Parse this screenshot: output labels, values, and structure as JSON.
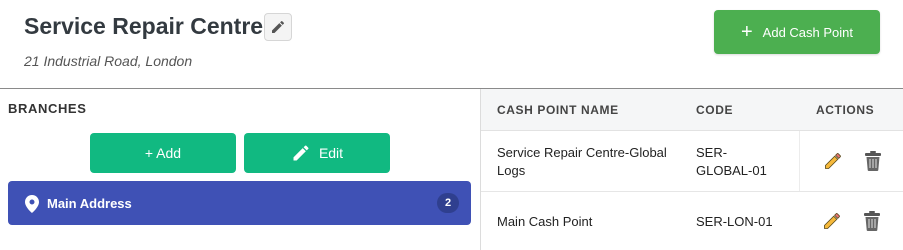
{
  "header": {
    "title": "Service Repair Centre",
    "address": "21 Industrial Road, London",
    "add_cash_point_label": "Add Cash Point"
  },
  "branches": {
    "title": "BRANCHES",
    "add_label": "+ Add",
    "edit_label": "Edit",
    "items": [
      {
        "label": "Main Address",
        "count": "2"
      }
    ]
  },
  "table": {
    "columns": [
      "CASH POINT NAME",
      "CODE",
      "ACTIONS"
    ],
    "rows": [
      {
        "name": "Service Repair Centre-Global Logs",
        "code": "SER-GLOBAL-01"
      },
      {
        "name": "Main Cash Point",
        "code": "SER-LON-01"
      }
    ]
  },
  "colors": {
    "accent_green": "#4caf50",
    "branch_button_green": "#11b981",
    "branch_selected_blue": "#3f51b5",
    "edit_icon_yellow": "#f6b93b",
    "delete_icon_gray": "#555555"
  },
  "icons": {
    "title_edit": "pencil-icon",
    "add_cash_point": "plus-icon",
    "branch_edit": "pencil-icon",
    "branch_location": "map-pin-icon",
    "row_edit": "pencil-icon",
    "row_delete": "trash-icon"
  }
}
